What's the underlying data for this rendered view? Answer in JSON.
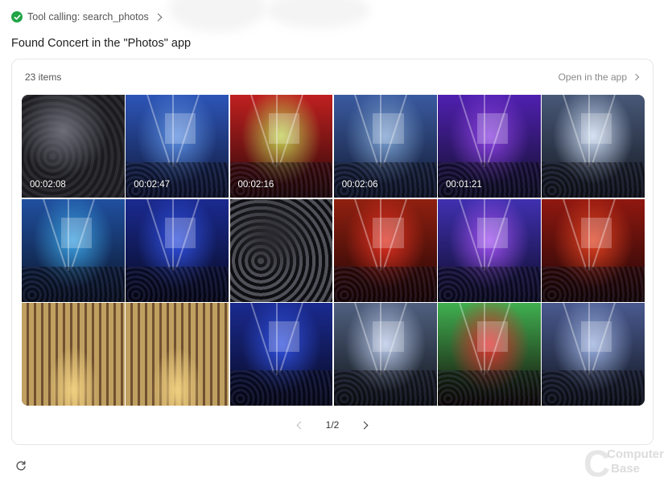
{
  "tool": {
    "label": "Tool calling: search_photos",
    "status_color": "#22a447"
  },
  "result_text": "Found Concert in the \"Photos\" app",
  "card": {
    "items_count": "23 items",
    "open_app_label": "Open in the app",
    "pagination": "1/2"
  },
  "tiles": [
    {
      "duration": "00:02:08",
      "colors": [
        "#2b2b30",
        "#6c6e78",
        "#1a1a1f"
      ],
      "kind": "crowd-bw"
    },
    {
      "duration": "00:02:47",
      "colors": [
        "#5a8ee0",
        "#2d55b8",
        "#101838"
      ],
      "kind": "stage-blue"
    },
    {
      "duration": "00:02:16",
      "colors": [
        "#c0d050",
        "#c02020",
        "#2a0808"
      ],
      "kind": "stage-red"
    },
    {
      "duration": "00:02:06",
      "colors": [
        "#7aa0d0",
        "#3a5aa0",
        "#121a30"
      ],
      "kind": "stage-blue"
    },
    {
      "duration": "00:01:21",
      "colors": [
        "#8a40e0",
        "#5020b0",
        "#10102a"
      ],
      "kind": "stage-purple"
    },
    {
      "duration": "",
      "colors": [
        "#c8d8f0",
        "#485878",
        "#141820"
      ],
      "kind": "stage-white"
    },
    {
      "duration": "",
      "colors": [
        "#3aa0e0",
        "#2050a0",
        "#0a1428"
      ],
      "kind": "stage-blue"
    },
    {
      "duration": "",
      "colors": [
        "#3050e0",
        "#1a2a90",
        "#080a20"
      ],
      "kind": "stage-blue"
    },
    {
      "duration": "",
      "colors": [
        "#505058",
        "#2a2a30",
        "#0e0e12"
      ],
      "kind": "crowd-bw"
    },
    {
      "duration": "",
      "colors": [
        "#e03020",
        "#902010",
        "#200505"
      ],
      "kind": "stage-red"
    },
    {
      "duration": "",
      "colors": [
        "#a050f0",
        "#4030b0",
        "#0c0c28"
      ],
      "kind": "stage-purple"
    },
    {
      "duration": "",
      "colors": [
        "#e04020",
        "#901810",
        "#1c0606"
      ],
      "kind": "stage-red"
    },
    {
      "duration": "",
      "colors": [
        "#c0a060",
        "#705030",
        "#201408"
      ],
      "kind": "cathedral"
    },
    {
      "duration": "",
      "colors": [
        "#c0a060",
        "#705030",
        "#201408"
      ],
      "kind": "cathedral"
    },
    {
      "duration": "",
      "colors": [
        "#3050e0",
        "#1a2a90",
        "#080a20"
      ],
      "kind": "stage-blue"
    },
    {
      "duration": "",
      "colors": [
        "#b8c8e8",
        "#506080",
        "#101418"
      ],
      "kind": "stage-white"
    },
    {
      "duration": "",
      "colors": [
        "#e03030",
        "#40b050",
        "#140808"
      ],
      "kind": "stage-red"
    },
    {
      "duration": "",
      "colors": [
        "#9ab0e0",
        "#4a5a90",
        "#10141c"
      ],
      "kind": "stage-white"
    }
  ],
  "icons": {
    "tool_status": "check-circle-icon",
    "tool_chevron": "chevron-right-icon",
    "open_app_chevron": "chevron-right-icon",
    "prev": "chevron-left-icon",
    "next": "chevron-right-icon",
    "refresh": "refresh-icon"
  },
  "watermark": {
    "line1": "Computer",
    "line2": "Base"
  }
}
